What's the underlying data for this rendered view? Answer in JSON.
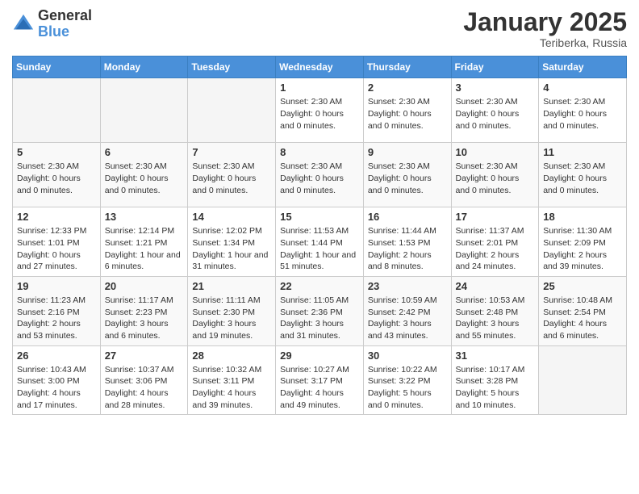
{
  "logo": {
    "general": "General",
    "blue": "Blue"
  },
  "header": {
    "month": "January 2025",
    "location": "Teriberka, Russia"
  },
  "weekdays": [
    "Sunday",
    "Monday",
    "Tuesday",
    "Wednesday",
    "Thursday",
    "Friday",
    "Saturday"
  ],
  "weeks": [
    [
      {
        "day": "",
        "info": ""
      },
      {
        "day": "",
        "info": ""
      },
      {
        "day": "",
        "info": ""
      },
      {
        "day": "1",
        "info": "Sunset: 2:30 AM\nDaylight: 0 hours\nand 0 minutes."
      },
      {
        "day": "2",
        "info": "Sunset: 2:30 AM\nDaylight: 0 hours\nand 0 minutes."
      },
      {
        "day": "3",
        "info": "Sunset: 2:30 AM\nDaylight: 0 hours\nand 0 minutes."
      },
      {
        "day": "4",
        "info": "Sunset: 2:30 AM\nDaylight: 0 hours\nand 0 minutes."
      }
    ],
    [
      {
        "day": "5",
        "info": "Sunset: 2:30 AM\nDaylight: 0 hours\nand 0 minutes."
      },
      {
        "day": "6",
        "info": "Sunset: 2:30 AM\nDaylight: 0 hours\nand 0 minutes."
      },
      {
        "day": "7",
        "info": "Sunset: 2:30 AM\nDaylight: 0 hours\nand 0 minutes."
      },
      {
        "day": "8",
        "info": "Sunset: 2:30 AM\nDaylight: 0 hours\nand 0 minutes."
      },
      {
        "day": "9",
        "info": "Sunset: 2:30 AM\nDaylight: 0 hours\nand 0 minutes."
      },
      {
        "day": "10",
        "info": "Sunset: 2:30 AM\nDaylight: 0 hours\nand 0 minutes."
      },
      {
        "day": "11",
        "info": "Sunset: 2:30 AM\nDaylight: 0 hours\nand 0 minutes."
      }
    ],
    [
      {
        "day": "12",
        "info": "Sunrise: 12:33 PM\nSunset: 1:01 PM\nDaylight: 0 hours\nand 27 minutes."
      },
      {
        "day": "13",
        "info": "Sunrise: 12:14 PM\nSunset: 1:21 PM\nDaylight: 1 hour and\n6 minutes."
      },
      {
        "day": "14",
        "info": "Sunrise: 12:02 PM\nSunset: 1:34 PM\nDaylight: 1 hour and\n31 minutes."
      },
      {
        "day": "15",
        "info": "Sunrise: 11:53 AM\nSunset: 1:44 PM\nDaylight: 1 hour and\n51 minutes."
      },
      {
        "day": "16",
        "info": "Sunrise: 11:44 AM\nSunset: 1:53 PM\nDaylight: 2 hours\nand 8 minutes."
      },
      {
        "day": "17",
        "info": "Sunrise: 11:37 AM\nSunset: 2:01 PM\nDaylight: 2 hours\nand 24 minutes."
      },
      {
        "day": "18",
        "info": "Sunrise: 11:30 AM\nSunset: 2:09 PM\nDaylight: 2 hours\nand 39 minutes."
      }
    ],
    [
      {
        "day": "19",
        "info": "Sunrise: 11:23 AM\nSunset: 2:16 PM\nDaylight: 2 hours\nand 53 minutes."
      },
      {
        "day": "20",
        "info": "Sunrise: 11:17 AM\nSunset: 2:23 PM\nDaylight: 3 hours\nand 6 minutes."
      },
      {
        "day": "21",
        "info": "Sunrise: 11:11 AM\nSunset: 2:30 PM\nDaylight: 3 hours\nand 19 minutes."
      },
      {
        "day": "22",
        "info": "Sunrise: 11:05 AM\nSunset: 2:36 PM\nDaylight: 3 hours\nand 31 minutes."
      },
      {
        "day": "23",
        "info": "Sunrise: 10:59 AM\nSunset: 2:42 PM\nDaylight: 3 hours\nand 43 minutes."
      },
      {
        "day": "24",
        "info": "Sunrise: 10:53 AM\nSunset: 2:48 PM\nDaylight: 3 hours\nand 55 minutes."
      },
      {
        "day": "25",
        "info": "Sunrise: 10:48 AM\nSunset: 2:54 PM\nDaylight: 4 hours\nand 6 minutes."
      }
    ],
    [
      {
        "day": "26",
        "info": "Sunrise: 10:43 AM\nSunset: 3:00 PM\nDaylight: 4 hours\nand 17 minutes."
      },
      {
        "day": "27",
        "info": "Sunrise: 10:37 AM\nSunset: 3:06 PM\nDaylight: 4 hours\nand 28 minutes."
      },
      {
        "day": "28",
        "info": "Sunrise: 10:32 AM\nSunset: 3:11 PM\nDaylight: 4 hours\nand 39 minutes."
      },
      {
        "day": "29",
        "info": "Sunrise: 10:27 AM\nSunset: 3:17 PM\nDaylight: 4 hours\nand 49 minutes."
      },
      {
        "day": "30",
        "info": "Sunrise: 10:22 AM\nSunset: 3:22 PM\nDaylight: 5 hours\nand 0 minutes."
      },
      {
        "day": "31",
        "info": "Sunrise: 10:17 AM\nSunset: 3:28 PM\nDaylight: 5 hours\nand 10 minutes."
      },
      {
        "day": "",
        "info": ""
      }
    ]
  ]
}
